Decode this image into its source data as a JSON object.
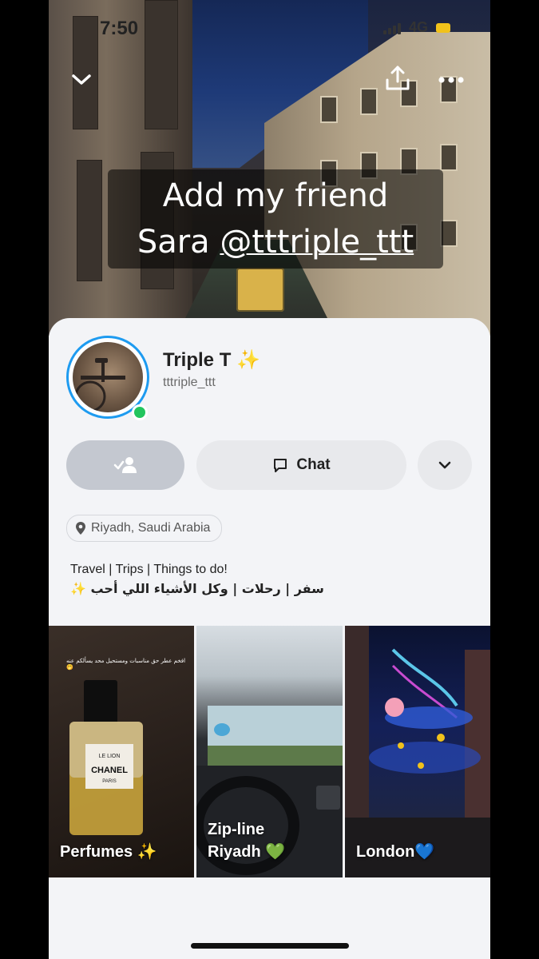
{
  "status": {
    "time": "7:50",
    "network": "4G"
  },
  "story": {
    "caption_line1": "Add my friend",
    "caption_line2_prefix": "Sara ",
    "caption_handle": "@tttriple_ttt"
  },
  "profile": {
    "name": "Triple T",
    "name_emoji": "✨",
    "username": "tttriple_ttt",
    "location": "Riyadh, Saudi Arabia",
    "bio_line1": "Travel | Trips | Things to do!",
    "bio_line2": "سفر | رحلات | وكل الأشياء اللي أحب ✨"
  },
  "actions": {
    "chat_label": "Chat"
  },
  "highlights": [
    {
      "label_line1": "Perfumes ✨",
      "label_line2": "",
      "overlay_text": "افخم عطر حق مناسبات ومستحيل محد يسألكم عنه 🤭"
    },
    {
      "label_line1": "Zip-line",
      "label_line2": "Riyadh 💚"
    },
    {
      "label_line1": "London💙",
      "label_line2": ""
    }
  ],
  "colors": {
    "story_ring": "#1e9bf0",
    "online": "#23c55e",
    "battery": "#f1c21b"
  },
  "icons": [
    "chevron-down-icon",
    "share-icon",
    "more-icon",
    "friend-check-icon",
    "chat-icon",
    "location-pin-icon"
  ]
}
